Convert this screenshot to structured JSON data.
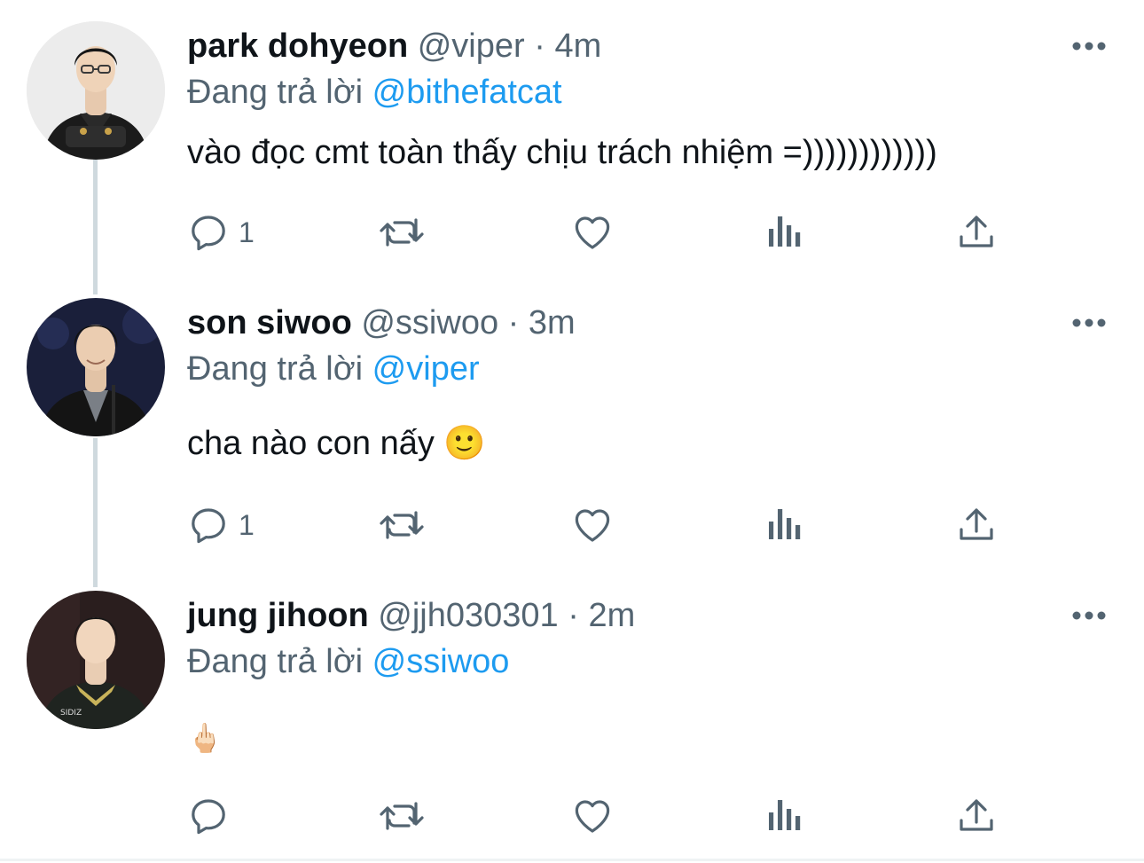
{
  "colors": {
    "text": "#0f1419",
    "secondary": "#536471",
    "link": "#1d9bf0",
    "thread_line": "#cfd9de"
  },
  "tweets": [
    {
      "name": "park dohyeon",
      "handle": "@viper",
      "separator": "·",
      "time": "4m",
      "replying_prefix": "Đang trả lời",
      "replying_to": "@bithefatcat",
      "text": "vào đọc cmt toàn thấy chịu trách nhiệm =))))))))))))",
      "reply_count": "1",
      "avatar_icon": "avatar-photo"
    },
    {
      "name": "son siwoo",
      "handle": "@ssiwoo",
      "separator": "·",
      "time": "3m",
      "replying_prefix": "Đang trả lời",
      "replying_to": "@viper",
      "text": "cha nào con nấy 🙂",
      "reply_count": "1",
      "avatar_icon": "avatar-photo"
    },
    {
      "name": "jung jihoon",
      "handle": "@jjh030301",
      "separator": "·",
      "time": "2m",
      "replying_prefix": "Đang trả lời",
      "replying_to": "@ssiwoo",
      "text": "🖕🏻",
      "reply_count": "",
      "avatar_icon": "avatar-photo"
    }
  ],
  "action_icons": [
    "reply-icon",
    "retweet-icon",
    "like-icon",
    "analytics-icon",
    "share-icon"
  ]
}
